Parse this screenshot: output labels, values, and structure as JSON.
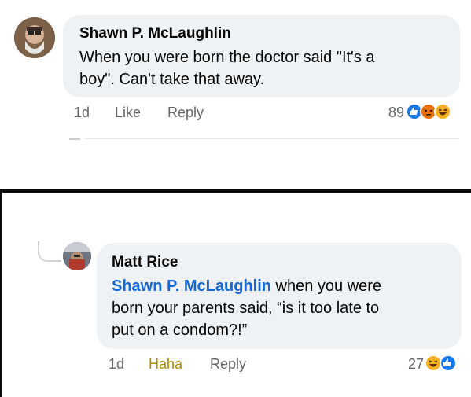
{
  "comment1": {
    "author": "Shawn P. McLaughlin",
    "text_line1": "When you were born the doctor said \"It's a",
    "text_line2": "boy\". Can't take that away.",
    "time": "1d",
    "action_like": "Like",
    "action_reply": "Reply",
    "reaction_count": "89",
    "reactions": [
      "like-icon",
      "angry-icon",
      "haha-icon"
    ]
  },
  "comment2": {
    "author": "Matt Rice",
    "mention": "Shawn P. McLaughlin",
    "text_line1_rest": " when you were",
    "text_line2": "born your parents said, “is it too late to",
    "text_line3": "put on a condom?!”",
    "time": "1d",
    "action_haha": "Haha",
    "action_reply": "Reply",
    "reaction_count": "27",
    "reactions": [
      "haha-icon",
      "like-icon"
    ]
  },
  "colors": {
    "bubble": "#eff2f5",
    "mention": "#1467d6",
    "haha_action": "#b38b00",
    "like": "#1877f2",
    "angry": "#e9710f",
    "haha": "#f7b125",
    "secondary_text": "#65676b"
  }
}
